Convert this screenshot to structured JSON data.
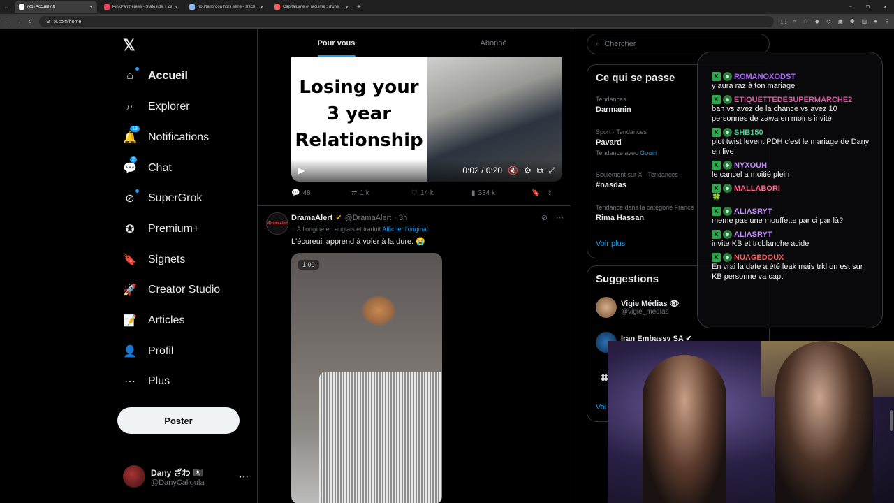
{
  "browser": {
    "tabs": [
      {
        "title": "(21) Accueil / X",
        "active": true,
        "color": "#ffffff"
      },
      {
        "title": "PinkPantheress - Stateside + Za",
        "active": false,
        "color": "#ff3b5c"
      },
      {
        "title": "hourla lordon hors série - Rech",
        "active": false,
        "color": "#8ab4f8"
      },
      {
        "title": "Capitalisme et racisme : d'une",
        "active": false,
        "color": "#ff5c5c"
      }
    ],
    "url": "x.com/home"
  },
  "nav": {
    "logo": "𝕏",
    "items": [
      {
        "label": "Accueil",
        "icon": "home-icon",
        "glyph": "⌂",
        "badge": "",
        "dot": true,
        "bold": true
      },
      {
        "label": "Explorer",
        "icon": "search-icon",
        "glyph": "⌕",
        "badge": "",
        "dot": false,
        "bold": false
      },
      {
        "label": "Notifications",
        "icon": "bell-icon",
        "glyph": "🔔",
        "badge": "19",
        "dot": false,
        "bold": false
      },
      {
        "label": "Chat",
        "icon": "chat-icon",
        "glyph": "💬",
        "badge": "2",
        "dot": false,
        "bold": false
      },
      {
        "label": "SuperGrok",
        "icon": "grok-icon",
        "glyph": "⊘",
        "badge": "",
        "dot": true,
        "bold": false
      },
      {
        "label": "Premium+",
        "icon": "premium-icon",
        "glyph": "✪",
        "badge": "",
        "dot": false,
        "bold": false
      },
      {
        "label": "Signets",
        "icon": "bookmark-icon",
        "glyph": "🔖",
        "badge": "",
        "dot": false,
        "bold": false
      },
      {
        "label": "Creator Studio",
        "icon": "rocket-icon",
        "glyph": "🚀",
        "badge": "",
        "dot": false,
        "bold": false
      },
      {
        "label": "Articles",
        "icon": "article-icon",
        "glyph": "📝",
        "badge": "",
        "dot": false,
        "bold": false
      },
      {
        "label": "Profil",
        "icon": "profile-icon",
        "glyph": "👤",
        "badge": "",
        "dot": false,
        "bold": false
      },
      {
        "label": "Plus",
        "icon": "more-circle-icon",
        "glyph": "⋯",
        "badge": "",
        "dot": false,
        "bold": false
      }
    ],
    "post_label": "Poster",
    "profile": {
      "name": "Dany ざわ 🏴‍☠️",
      "handle": "@DanyCaligula"
    }
  },
  "feed": {
    "tabs": [
      {
        "label": "Pour vous",
        "active": true
      },
      {
        "label": "Abonné",
        "active": false
      }
    ],
    "tweet1": {
      "media_text": [
        "Losing your",
        "3 year",
        "Relationship"
      ],
      "video_time": "0:02 / 0:20",
      "replies": "48",
      "reposts": "1 k",
      "likes": "14 k",
      "views": "334 k"
    },
    "tweet2": {
      "avatar_text": "#DramaAlert",
      "name": "DramaAlert",
      "handle": "@DramaAlert",
      "time": "· 3h",
      "translated_note": "À l'origine en anglais et traduit",
      "show_original": "Afficher l'original",
      "text": "L'écureuil apprend à voler à la dure. 😭",
      "video_time": "1:00"
    }
  },
  "right": {
    "search_placeholder": "Chercher",
    "trends_title": "Ce qui se passe",
    "trends": [
      {
        "context": "Tendances",
        "name": "Darmanin",
        "sub": "",
        "sub_link": ""
      },
      {
        "context": "Sport · Tendances",
        "name": "Pavard",
        "sub": "Tendance avec",
        "sub_link": "Gouiri"
      },
      {
        "context": "Seulement sur X · Tendances",
        "name": "#nasdas",
        "sub": "",
        "sub_link": ""
      },
      {
        "context": "Tendance dans la catégorie France",
        "name": "Rima Hassan",
        "sub": "",
        "sub_link": ""
      }
    ],
    "show_more": "Voir plus",
    "suggestions_title": "Suggestions",
    "suggestions": [
      {
        "name": "Vigie Médias 👁",
        "handle": "@vigie_medias"
      },
      {
        "name": "Iran Embassy SA ✔",
        "handle": "@"
      }
    ],
    "suggestions_more": "Voi"
  },
  "stream_chat": {
    "messages": [
      {
        "user": "ROMANOXODST",
        "color": "#b06cff",
        "text": "y aura raz à ton mariage"
      },
      {
        "user": "ETIQUETTEDESUPERMARCHE2",
        "color": "#e05aa6",
        "text": "bah vs avez de la chance vs avez 10 personnes de zawa en moins invité"
      },
      {
        "user": "SHB150",
        "color": "#46d18c",
        "text": "plot twist levent PDH c'est le mariage de Dany en live"
      },
      {
        "user": "NYXOUH",
        "color": "#c58cff",
        "text": "le cancel a moitié plein"
      },
      {
        "user": "MALLABORI",
        "color": "#ff6a8a",
        "text": "🍀"
      },
      {
        "user": "ALIASRYT",
        "color": "#c58cff",
        "text": "meme pas une mouffette par ci par là?"
      },
      {
        "user": "ALIASRYT",
        "color": "#c58cff",
        "text": "invite KB et troblanche acide"
      },
      {
        "user": "NUAGEDOUX",
        "color": "#ff5a5a",
        "text": "En vrai la date a été leak mais trkl on est sur KB personne va capt"
      }
    ]
  }
}
